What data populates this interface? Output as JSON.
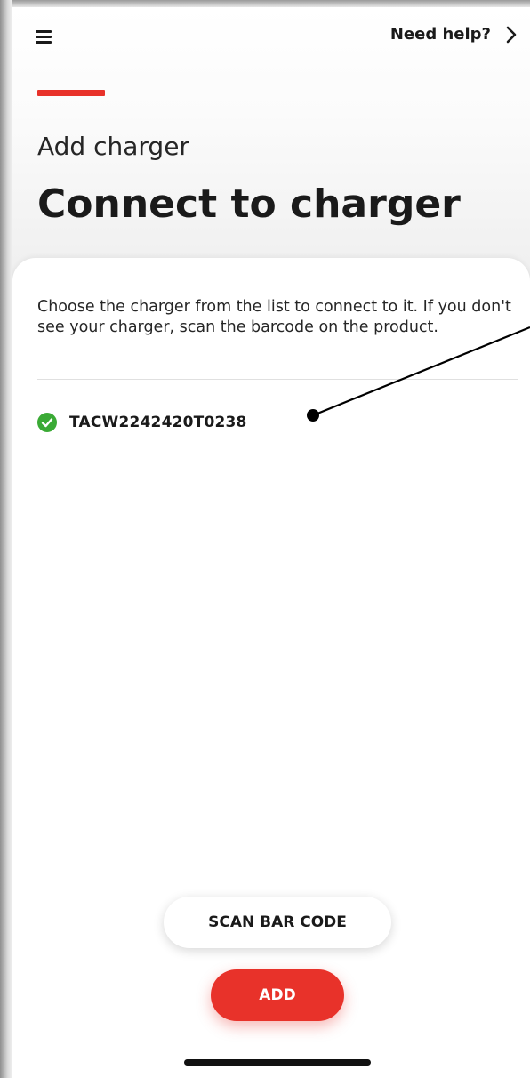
{
  "header": {
    "menu_icon": "hamburger-menu-icon",
    "help_label": "Need help?",
    "help_icon": "chevron-right-icon",
    "accent_color": "#e8322a"
  },
  "page": {
    "subtitle": "Add charger",
    "title": "Connect to charger"
  },
  "card": {
    "instructions": "Choose the charger from the list to connect to it. If you don't see your charger, scan the barcode on the product.",
    "chargers": [
      {
        "id": "TACW2242420T0238",
        "status_icon": "check-circle-icon",
        "status_color": "#3aaa35"
      }
    ]
  },
  "actions": {
    "scan_label": "SCAN BAR CODE",
    "add_label": "ADD",
    "add_color": "#e8322a"
  }
}
